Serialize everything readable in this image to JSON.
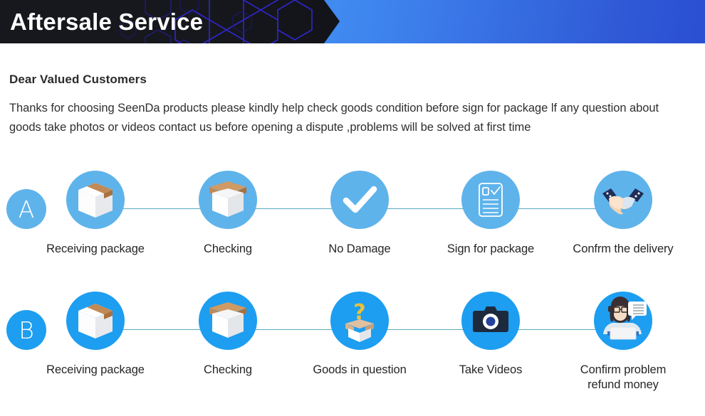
{
  "header": {
    "title": "Aftersale Service",
    "dark_bg": "#17181d",
    "accent_light": "#53b2fb",
    "accent_deep": "#2b4fd2",
    "hex_stroke": "#2a21c8"
  },
  "intro": {
    "salutation": "Dear Valued Customers",
    "paragraph": "Thanks for choosing SeenDa products please kindly help check goods condition before sign for package lf any question about goods take photos or videos contact us before opening a dispute ,problems will be solved at first time"
  },
  "flows": [
    {
      "badge": "A",
      "circle_color": "#5fb3eb",
      "line_color": "#3d9ab2",
      "steps": [
        {
          "label": "Receiving package",
          "icon": "sealed-box-icon"
        },
        {
          "label": "Checking",
          "icon": "open-box-icon"
        },
        {
          "label": "No Damage",
          "icon": "check-mark-icon"
        },
        {
          "label": "Sign for package",
          "icon": "signed-document-icon"
        },
        {
          "label": "Confrm the delivery",
          "icon": "handshake-icon"
        }
      ]
    },
    {
      "badge": "B",
      "circle_color": "#1d9ef0",
      "line_color": "#3d9ab2",
      "steps": [
        {
          "label": "Receiving package",
          "icon": "sealed-box-icon"
        },
        {
          "label": "Checking",
          "icon": "open-box-icon"
        },
        {
          "label": "Goods in question",
          "icon": "question-box-icon"
        },
        {
          "label": "Take Videos",
          "icon": "camera-icon"
        },
        {
          "label": "Confirm problem\nrefund money",
          "icon": "support-agent-icon"
        }
      ]
    }
  ]
}
